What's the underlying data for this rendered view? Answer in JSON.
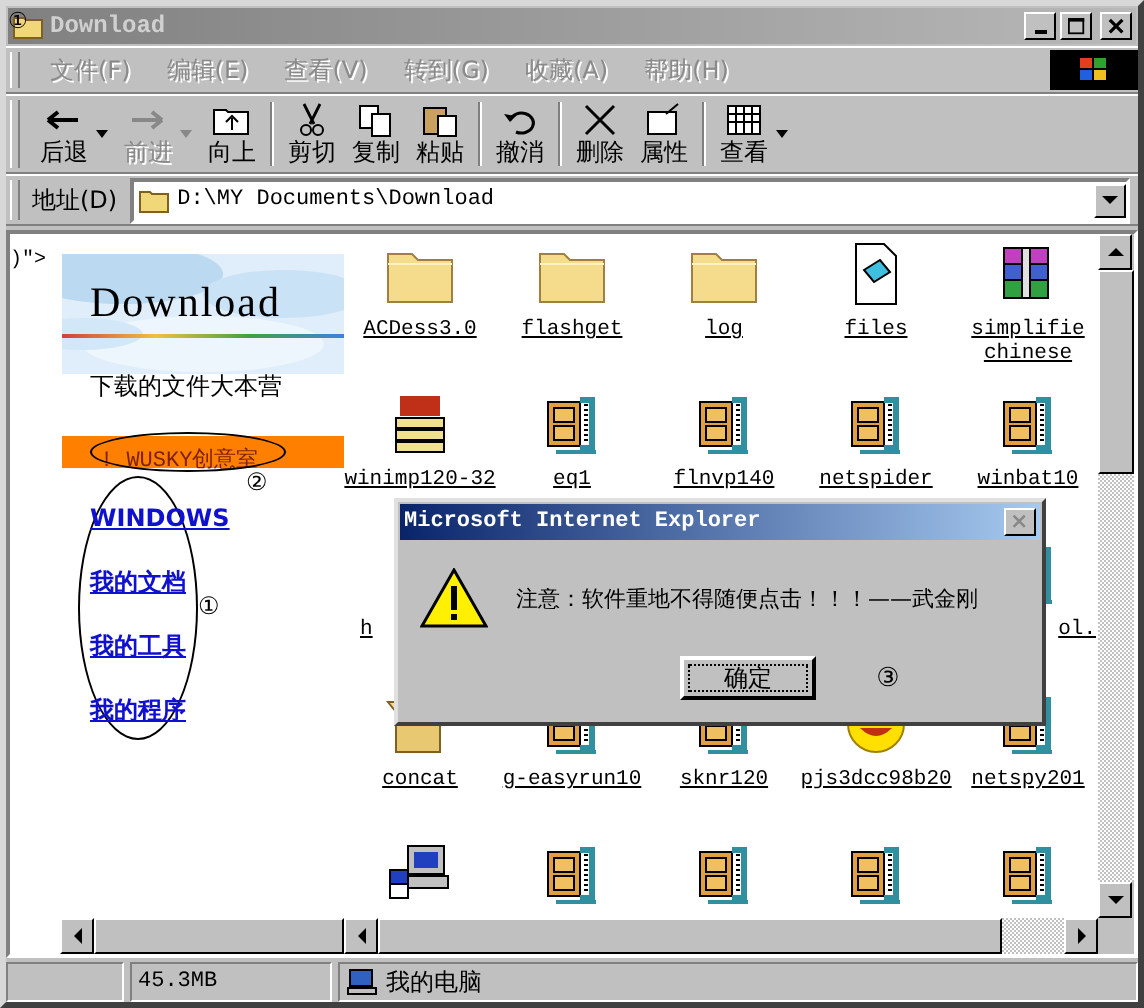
{
  "window": {
    "title": "Download",
    "annotation": "①"
  },
  "menu": [
    "文件(F)",
    "编辑(E)",
    "查看(V)",
    "转到(G)",
    "收藏(A)",
    "帮助(H)"
  ],
  "toolbar": [
    {
      "kind": "back",
      "label": "后退",
      "disabled": false,
      "dropdown": true
    },
    {
      "kind": "forward",
      "label": "前进",
      "disabled": true,
      "dropdown": true
    },
    {
      "kind": "up",
      "label": "向上",
      "disabled": false,
      "dropdown": false
    },
    {
      "kind": "cut",
      "label": "剪切",
      "disabled": false,
      "dropdown": false
    },
    {
      "kind": "copy",
      "label": "复制",
      "disabled": false,
      "dropdown": false
    },
    {
      "kind": "paste",
      "label": "粘贴",
      "disabled": false,
      "dropdown": false
    },
    {
      "kind": "undo",
      "label": "撤消",
      "disabled": false,
      "dropdown": false
    },
    {
      "kind": "delete",
      "label": "删除",
      "disabled": false,
      "dropdown": false
    },
    {
      "kind": "properties",
      "label": "属性",
      "disabled": false,
      "dropdown": false
    },
    {
      "kind": "views",
      "label": "查看",
      "disabled": false,
      "dropdown": true
    }
  ],
  "address": {
    "label": "地址(D)",
    "value": "D:\\MY Documents\\Download"
  },
  "web_panel": {
    "code_fragment": ")\">",
    "title": "Download",
    "subtitle": "下载的文件大本营",
    "highlight_link": "! WUSKY创意室",
    "highlight_annotation": "②",
    "links": [
      "WINDOWS",
      "我的文档",
      "我的工具",
      "我的程序"
    ],
    "links_annotation": "①"
  },
  "files": [
    {
      "kind": "folder",
      "label": "ACDess3.0"
    },
    {
      "kind": "folder",
      "label": "flashget"
    },
    {
      "kind": "folder",
      "label": "log"
    },
    {
      "kind": "document",
      "label": "files"
    },
    {
      "kind": "archive",
      "label": "simplifie chinese"
    },
    {
      "kind": "imp",
      "label": "winimp120-32"
    },
    {
      "kind": "zip",
      "label": "eq1"
    },
    {
      "kind": "zip",
      "label": "flnvp140"
    },
    {
      "kind": "zip",
      "label": "netspider"
    },
    {
      "kind": "zip",
      "label": "winbat10"
    },
    {
      "label": "h"
    },
    {
      "kind": "zip",
      "label": "ol."
    },
    {
      "kind": "box",
      "label": "concat"
    },
    {
      "kind": "zip",
      "label": "g-easyrun10"
    },
    {
      "kind": "zip",
      "label": "sknr120"
    },
    {
      "kind": "smiley",
      "label": "pjs3dcc98b20"
    },
    {
      "kind": "zip",
      "label": "netspy201"
    },
    {
      "kind": "setup"
    },
    {
      "kind": "zip"
    },
    {
      "kind": "zip"
    },
    {
      "kind": "zip"
    },
    {
      "kind": "zip"
    }
  ],
  "dialog": {
    "title": "Microsoft Internet Explorer",
    "message": "注意：软件重地不得随便点击！！！——武金刚",
    "button": "确定",
    "annotation": "③"
  },
  "status_bar": {
    "size": "45.3MB",
    "location": "我的电脑"
  }
}
